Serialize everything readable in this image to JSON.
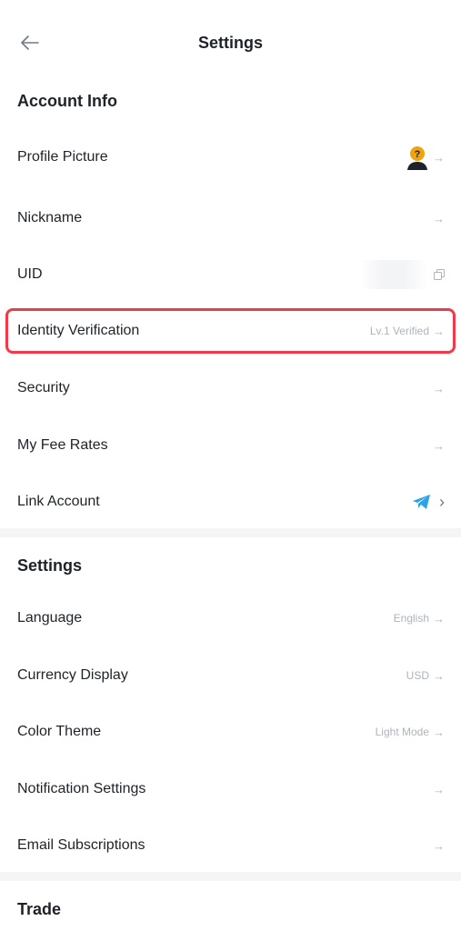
{
  "header": {
    "title": "Settings",
    "back_icon": "arrow-left-icon"
  },
  "sections": {
    "account": {
      "title": "Account Info",
      "items": {
        "profile_picture": {
          "label": "Profile Picture",
          "icon": "avatar-icon"
        },
        "nickname": {
          "label": "Nickname"
        },
        "uid": {
          "label": "UID",
          "icon": "copy-icon"
        },
        "identity": {
          "label": "Identity Verification",
          "value": "Lv.1 Verified"
        },
        "security": {
          "label": "Security"
        },
        "fee_rates": {
          "label": "My Fee Rates"
        },
        "link_account": {
          "label": "Link Account",
          "icon": "telegram-icon"
        }
      }
    },
    "settings": {
      "title": "Settings",
      "items": {
        "language": {
          "label": "Language",
          "value": "English"
        },
        "currency": {
          "label": "Currency Display",
          "value": "USD"
        },
        "color_theme": {
          "label": "Color Theme",
          "value": "Light Mode"
        },
        "notifications": {
          "label": "Notification Settings"
        },
        "email": {
          "label": "Email Subscriptions"
        }
      }
    },
    "trade": {
      "title": "Trade"
    }
  },
  "ui": {
    "arrow": "→",
    "chevron": "›"
  },
  "colors": {
    "text": "#1e2329",
    "muted": "#aeb4bc",
    "highlight": "#ef3b49",
    "telegram": "#2aa3e8",
    "avatar_bg": "#f0a30b"
  }
}
